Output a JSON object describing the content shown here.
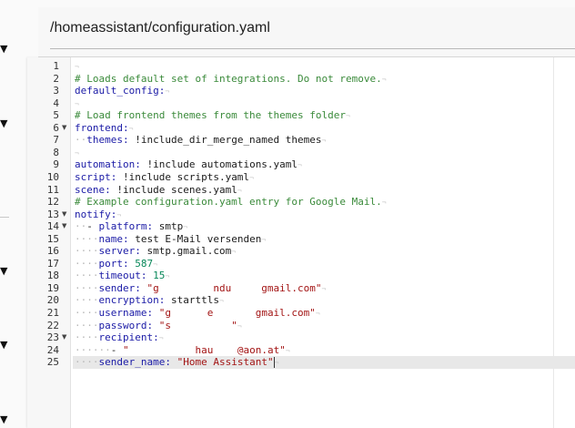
{
  "sidebar": {
    "arrow_glyph": "▼"
  },
  "header": {
    "file_path": "/homeassistant/configuration.yaml"
  },
  "editor": {
    "active_line": 25,
    "lines": [
      {
        "n": "1",
        "fold": false,
        "indent": 0,
        "tokens": []
      },
      {
        "n": "2",
        "fold": false,
        "indent": 0,
        "tokens": [
          {
            "t": "cmt",
            "v": "# Loads default set of integrations. Do not remove."
          }
        ]
      },
      {
        "n": "3",
        "fold": false,
        "indent": 0,
        "tokens": [
          {
            "t": "key",
            "v": "default_config:"
          }
        ]
      },
      {
        "n": "4",
        "fold": false,
        "indent": 0,
        "tokens": []
      },
      {
        "n": "5",
        "fold": false,
        "indent": 0,
        "tokens": [
          {
            "t": "cmt",
            "v": "# Load frontend themes from the themes folder"
          }
        ]
      },
      {
        "n": "6",
        "fold": true,
        "indent": 0,
        "tokens": [
          {
            "t": "key",
            "v": "frontend:"
          }
        ]
      },
      {
        "n": "7",
        "fold": false,
        "indent": 2,
        "tokens": [
          {
            "t": "key",
            "v": "themes:"
          },
          {
            "t": "txt",
            "v": " !include_dir_merge_named themes"
          }
        ]
      },
      {
        "n": "8",
        "fold": false,
        "indent": 0,
        "tokens": []
      },
      {
        "n": "9",
        "fold": false,
        "indent": 0,
        "tokens": [
          {
            "t": "key",
            "v": "automation:"
          },
          {
            "t": "txt",
            "v": " !include automations.yaml"
          }
        ]
      },
      {
        "n": "10",
        "fold": false,
        "indent": 0,
        "tokens": [
          {
            "t": "key",
            "v": "script:"
          },
          {
            "t": "txt",
            "v": " !include scripts.yaml"
          }
        ]
      },
      {
        "n": "11",
        "fold": false,
        "indent": 0,
        "tokens": [
          {
            "t": "key",
            "v": "scene:"
          },
          {
            "t": "txt",
            "v": " !include scenes.yaml"
          }
        ]
      },
      {
        "n": "12",
        "fold": false,
        "indent": 0,
        "tokens": [
          {
            "t": "cmt",
            "v": "# Example configuration.yaml entry for Google Mail."
          }
        ]
      },
      {
        "n": "13",
        "fold": true,
        "indent": 0,
        "tokens": [
          {
            "t": "key",
            "v": "notify:"
          }
        ]
      },
      {
        "n": "14",
        "fold": true,
        "indent": 2,
        "tokens": [
          {
            "t": "txt",
            "v": "- "
          },
          {
            "t": "key",
            "v": "platform:"
          },
          {
            "t": "txt",
            "v": " smtp"
          }
        ]
      },
      {
        "n": "15",
        "fold": false,
        "indent": 4,
        "tokens": [
          {
            "t": "key",
            "v": "name:"
          },
          {
            "t": "txt",
            "v": " test E-Mail versenden"
          }
        ]
      },
      {
        "n": "16",
        "fold": false,
        "indent": 4,
        "tokens": [
          {
            "t": "key",
            "v": "server:"
          },
          {
            "t": "txt",
            "v": " smtp.gmail.com"
          }
        ]
      },
      {
        "n": "17",
        "fold": false,
        "indent": 4,
        "tokens": [
          {
            "t": "key",
            "v": "port:"
          },
          {
            "t": "num",
            "v": " 587"
          }
        ]
      },
      {
        "n": "18",
        "fold": false,
        "indent": 4,
        "tokens": [
          {
            "t": "key",
            "v": "timeout:"
          },
          {
            "t": "num",
            "v": " 15"
          }
        ]
      },
      {
        "n": "19",
        "fold": false,
        "indent": 4,
        "tokens": [
          {
            "t": "key",
            "v": "sender:"
          },
          {
            "t": "str",
            "v": " \"g         ndu     gmail.com\""
          }
        ]
      },
      {
        "n": "20",
        "fold": false,
        "indent": 4,
        "tokens": [
          {
            "t": "key",
            "v": "encryption:"
          },
          {
            "t": "txt",
            "v": " starttls"
          }
        ]
      },
      {
        "n": "21",
        "fold": false,
        "indent": 4,
        "tokens": [
          {
            "t": "key",
            "v": "username:"
          },
          {
            "t": "str",
            "v": " \"g      e       gmail.com\""
          }
        ]
      },
      {
        "n": "22",
        "fold": false,
        "indent": 4,
        "tokens": [
          {
            "t": "key",
            "v": "password:"
          },
          {
            "t": "str",
            "v": " \"s          \""
          }
        ]
      },
      {
        "n": "23",
        "fold": true,
        "indent": 4,
        "tokens": [
          {
            "t": "key",
            "v": "recipient:"
          }
        ]
      },
      {
        "n": "24",
        "fold": false,
        "indent": 6,
        "tokens": [
          {
            "t": "txt",
            "v": "- "
          },
          {
            "t": "str",
            "v": "\"           hau    @aon.at\""
          }
        ]
      },
      {
        "n": "25",
        "fold": false,
        "indent": 4,
        "tokens": [
          {
            "t": "key",
            "v": "sender_name:"
          },
          {
            "t": "str",
            "v": " \"Home Assistant\""
          }
        ]
      }
    ]
  }
}
